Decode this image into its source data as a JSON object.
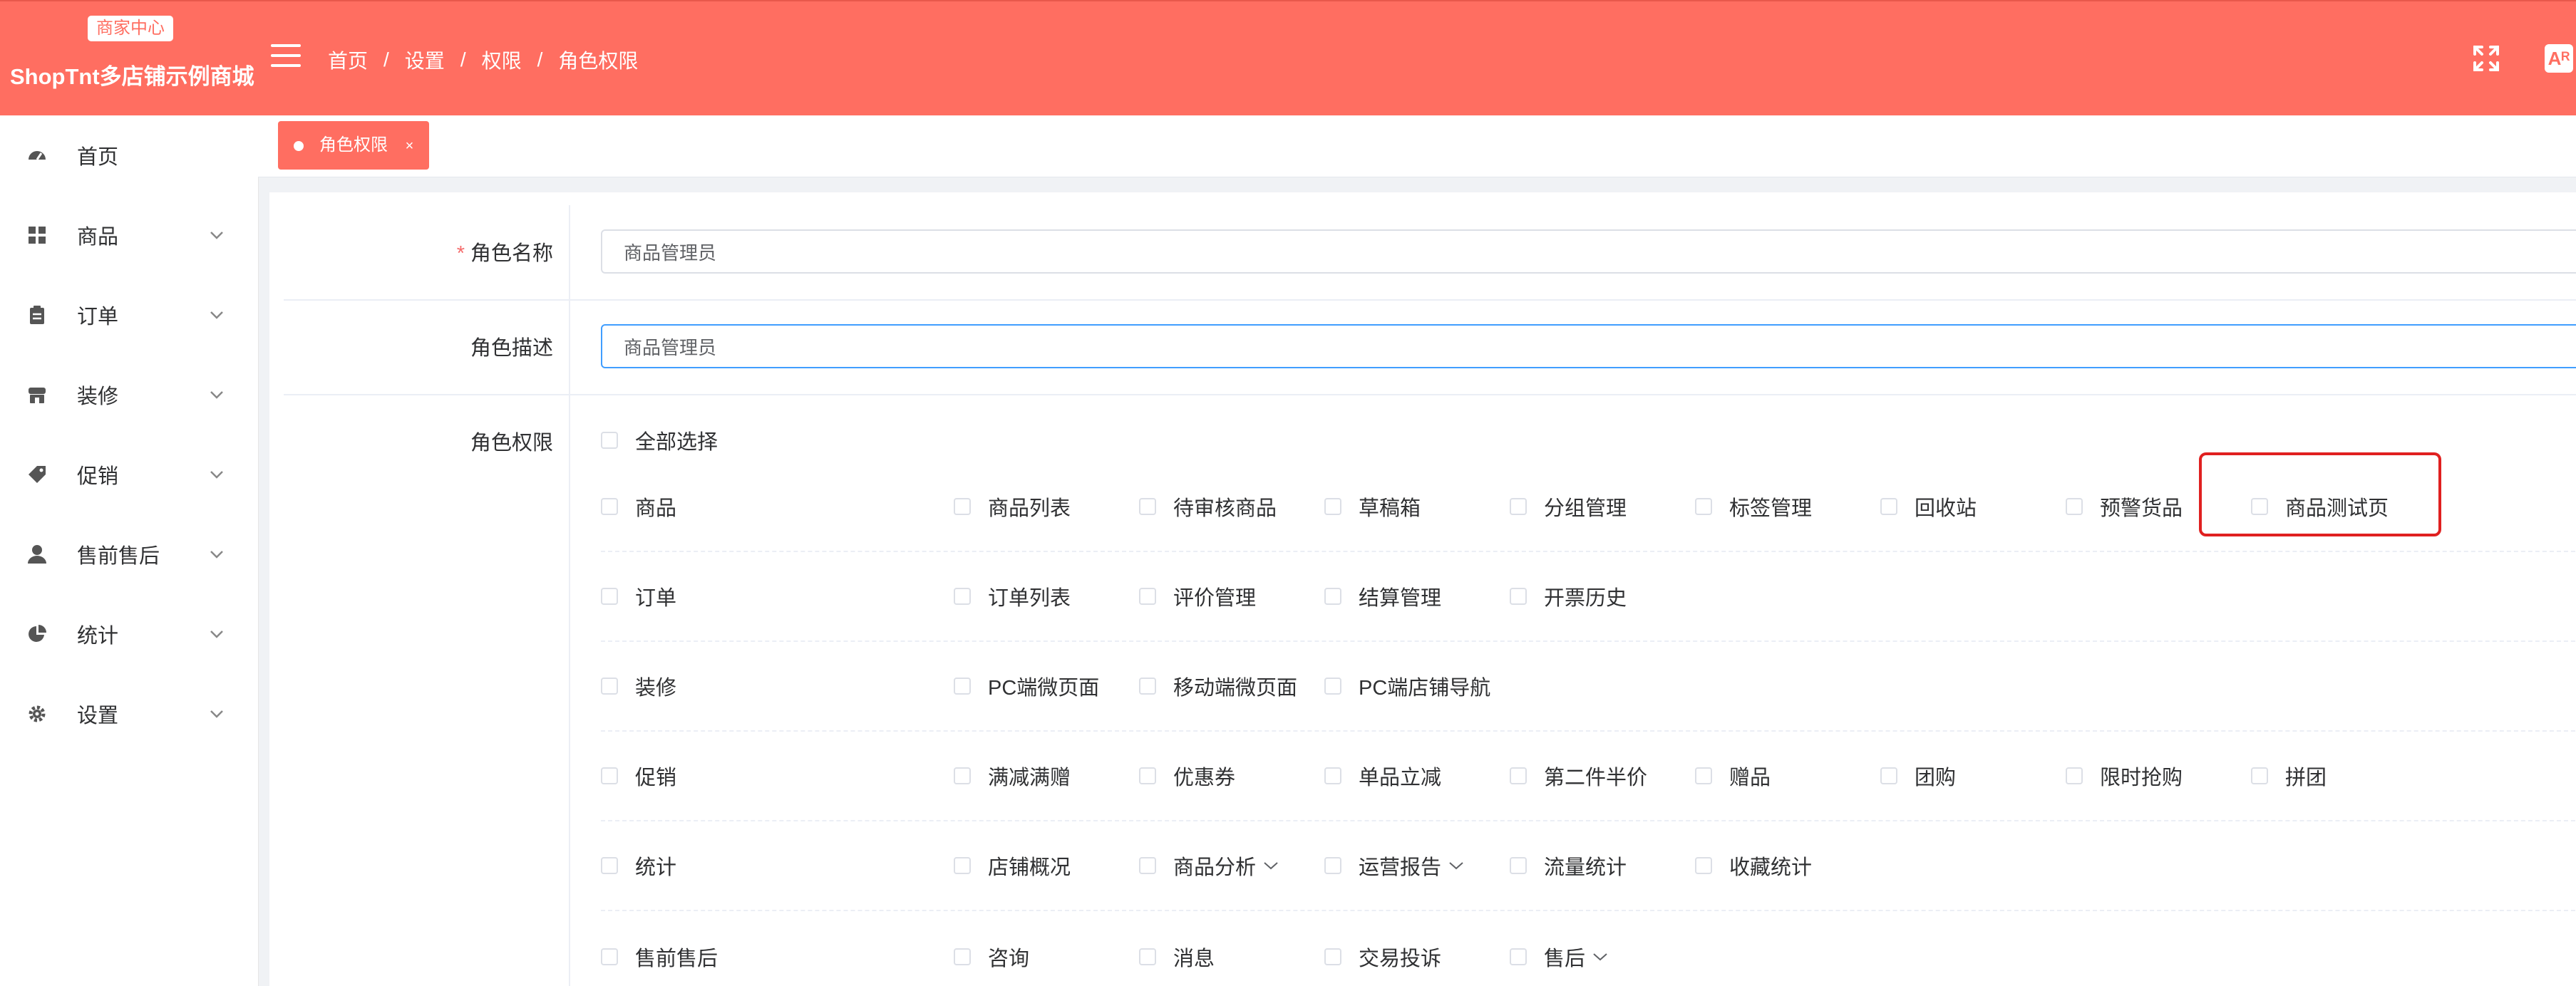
{
  "header": {
    "badge": "商家中心",
    "title": "ShopTnt多店铺示例商城",
    "breadcrumb": [
      "首页",
      "设置",
      "权限",
      "角色权限"
    ],
    "breadcrumb_sep": "/",
    "font_icon": "Aᴿ"
  },
  "colors": {
    "accent": "#ff6e61",
    "highlight": "#e02020",
    "focus": "#409eff"
  },
  "sidebar": {
    "items": [
      {
        "label": "首页",
        "icon": "dashboard-icon",
        "has_children": false
      },
      {
        "label": "商品",
        "icon": "grid-icon",
        "has_children": true
      },
      {
        "label": "订单",
        "icon": "clipboard-icon",
        "has_children": true
      },
      {
        "label": "装修",
        "icon": "store-icon",
        "has_children": true
      },
      {
        "label": "促销",
        "icon": "tag-icon",
        "has_children": true
      },
      {
        "label": "售前售后",
        "icon": "user-icon",
        "has_children": true
      },
      {
        "label": "统计",
        "icon": "pie-chart-icon",
        "has_children": true
      },
      {
        "label": "设置",
        "icon": "gear-icon",
        "has_children": true
      }
    ]
  },
  "tags": [
    {
      "label": "角色权限",
      "close": "×"
    }
  ],
  "form": {
    "name_label": "角色名称",
    "required_mark": "*",
    "name_value": "商品管理员",
    "desc_label": "角色描述",
    "desc_value": "商品管理员",
    "perm_label": "角色权限",
    "select_all": "全部选择",
    "groups": [
      {
        "label": "商品",
        "children": [
          "商品列表",
          "待审核商品",
          "草稿箱",
          "分组管理",
          "标签管理",
          "回收站",
          "预警货品",
          "商品测试页"
        ]
      },
      {
        "label": "订单",
        "children": [
          "订单列表",
          "评价管理",
          "结算管理",
          "开票历史"
        ]
      },
      {
        "label": "装修",
        "children": [
          "PC端微页面",
          "移动端微页面",
          "PC端店铺导航"
        ]
      },
      {
        "label": "促销",
        "children": [
          "满减满赠",
          "优惠券",
          "单品立减",
          "第二件半价",
          "赠品",
          "团购",
          "限时抢购",
          "拼团"
        ]
      },
      {
        "label": "统计",
        "children": [
          "店铺概况",
          "商品分析",
          "运营报告",
          "流量统计",
          "收藏统计"
        ]
      },
      {
        "label": "售前售后",
        "children": [
          "咨询",
          "消息",
          "交易投诉",
          "售后"
        ]
      }
    ]
  }
}
